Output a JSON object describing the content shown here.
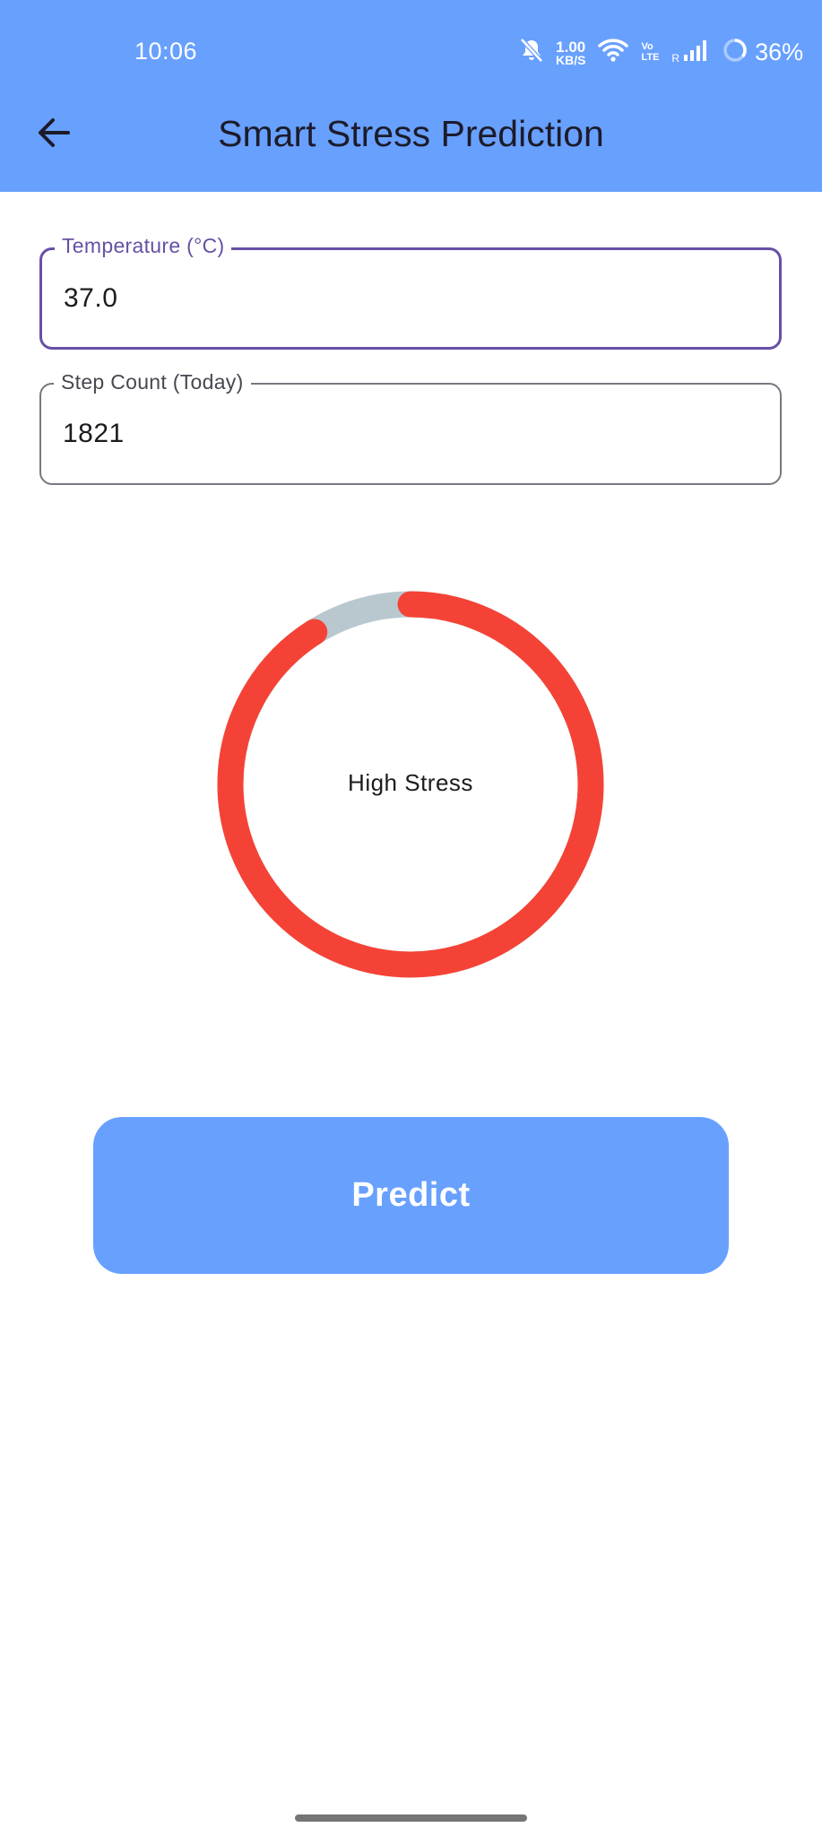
{
  "status_bar": {
    "time": "10:06",
    "network_speed_value": "1.00",
    "network_speed_unit": "KB/S",
    "volte_top": "Vo",
    "volte_bottom": "LTE",
    "roaming": "R",
    "battery": "36%",
    "icons": [
      "bell-muted-icon",
      "wifi-icon",
      "signal-icon",
      "battery-ring-icon"
    ]
  },
  "app_bar": {
    "title": "Smart Stress Prediction",
    "back_icon": "arrow-left-icon",
    "color": "#68a0fe"
  },
  "form": {
    "temperature": {
      "label": "Temperature (°C)",
      "value": "37.0"
    },
    "step_count": {
      "label": "Step Count (Today)",
      "value": "1821"
    }
  },
  "result": {
    "label": "High Stress",
    "gauge_fraction": 0.91,
    "gauge_color": "#f44336",
    "track_color": "#b9c8cf"
  },
  "actions": {
    "predict_label": "Predict"
  }
}
